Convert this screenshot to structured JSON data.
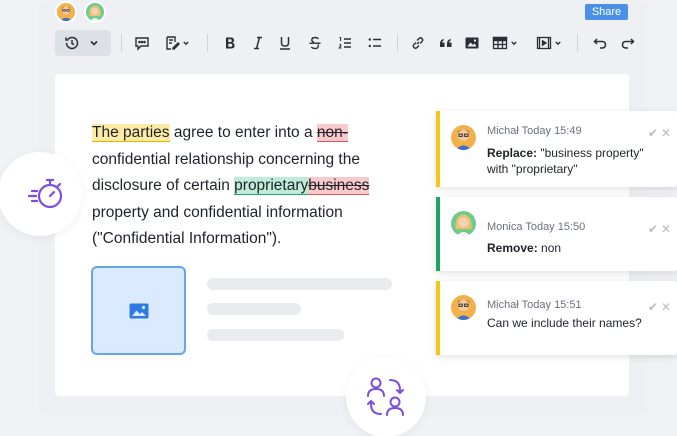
{
  "header": {
    "share_label": "Share",
    "collaborators": [
      {
        "name": "Michał",
        "icon": "avatar-man-icon"
      },
      {
        "name": "Monica",
        "icon": "avatar-woman-icon"
      }
    ]
  },
  "toolbar": {
    "buttons": [
      {
        "name": "history",
        "icon": "history-icon"
      },
      {
        "name": "comment",
        "icon": "comment-icon"
      },
      {
        "name": "track-changes",
        "icon": "track-changes-icon"
      },
      {
        "name": "bold",
        "icon": "bold-icon"
      },
      {
        "name": "italic",
        "icon": "italic-icon"
      },
      {
        "name": "underline",
        "icon": "underline-icon"
      },
      {
        "name": "strikethrough",
        "icon": "strikethrough-icon"
      },
      {
        "name": "numbered-list",
        "icon": "numbered-list-icon"
      },
      {
        "name": "bulleted-list",
        "icon": "bulleted-list-icon"
      },
      {
        "name": "link",
        "icon": "link-icon"
      },
      {
        "name": "quote",
        "icon": "quote-icon"
      },
      {
        "name": "image",
        "icon": "image-icon"
      },
      {
        "name": "table",
        "icon": "table-icon"
      },
      {
        "name": "media",
        "icon": "media-icon"
      },
      {
        "name": "undo",
        "icon": "undo-icon"
      },
      {
        "name": "redo",
        "icon": "redo-icon"
      }
    ]
  },
  "document": {
    "seg_1": "The parties",
    "seg_2": " agree to enter into a ",
    "seg_3": "non-",
    "seg_4": "confidential relationship concerning the disclosure of certain ",
    "seg_5": "proprietary",
    "seg_6": "business",
    "seg_7": " property and confidential information (\"Confidential Information\")."
  },
  "comments": [
    {
      "author": "Michał",
      "time": "Today 15:49",
      "label": "Replace:",
      "text": " \"business property\" with \"proprietary\"",
      "accent": "#f5c518"
    },
    {
      "author": "Monica",
      "time": "Today 15:50",
      "label": "Remove:",
      "text": " non",
      "accent": "#1fa463"
    },
    {
      "author": "Michał",
      "time": "Today 15:51",
      "text": "Can we include their names?",
      "accent": "#f5c518"
    }
  ],
  "colors": {
    "share_button": "#4a90e8",
    "insertion_highlight": "#bfecd9",
    "deletion_highlight": "#f9c9cb",
    "comment_highlight": "#fdeaa4",
    "feature_icon": "#7c4dde"
  },
  "feature_icons": [
    "stopwatch-icon",
    "users-swap-icon"
  ]
}
